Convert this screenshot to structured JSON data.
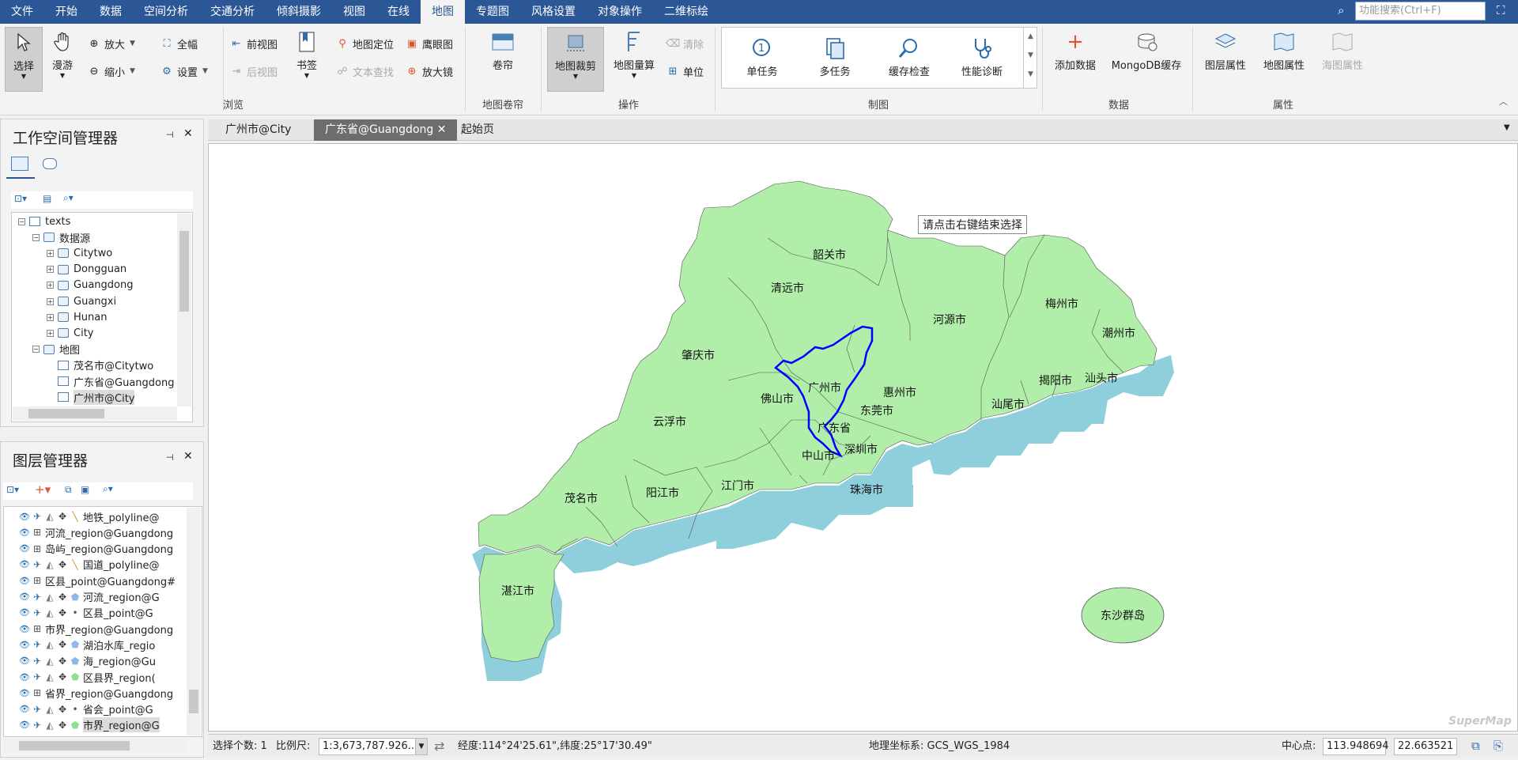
{
  "menu": [
    "文件",
    "开始",
    "数据",
    "空间分析",
    "交通分析",
    "倾斜摄影",
    "视图",
    "在线",
    "地图",
    "专题图",
    "风格设置",
    "对象操作",
    "二维标绘"
  ],
  "active_menu_index": 8,
  "search": {
    "placeholder": "功能搜索(Ctrl+F)"
  },
  "ribbon": {
    "browse": {
      "select": "选择",
      "pan": "漫游",
      "zoom_in": "放大",
      "zoom_out": "缩小",
      "full_extent": "全幅",
      "settings": "设置",
      "prev_view": "前视图",
      "next_view": "后视图",
      "bookmark": "书签",
      "locate": "地图定位",
      "text_search": "文本查找",
      "eagle_eye": "鹰眼图",
      "magnifier": "放大镜",
      "label": "浏览"
    },
    "swipe": {
      "swipe": "卷帘",
      "label": "地图卷帘"
    },
    "operate": {
      "clip": "地图裁剪",
      "measure": "地图量算",
      "clear": "清除",
      "unit": "单位",
      "label": "操作"
    },
    "mapping": {
      "single_task": "单任务",
      "multi_task": "多任务",
      "cache_check": "缓存检查",
      "diagnose": "性能诊断",
      "label": "制图"
    },
    "data": {
      "add_data": "添加数据",
      "mongodb": "MongoDB缓存",
      "label": "数据"
    },
    "props": {
      "layer_props": "图层属性",
      "map_props": "地图属性",
      "chart_props": "海图属性",
      "label": "属性"
    }
  },
  "workspace": {
    "title": "工作空间管理器",
    "tree": [
      {
        "label": "texts",
        "indent": 0,
        "type": "root"
      },
      {
        "label": "数据源",
        "indent": 1,
        "type": "folder"
      },
      {
        "label": "Citytwo",
        "indent": 2,
        "type": "db"
      },
      {
        "label": "Dongguan",
        "indent": 2,
        "type": "db"
      },
      {
        "label": "Guangdong",
        "indent": 2,
        "type": "db"
      },
      {
        "label": "Guangxi",
        "indent": 2,
        "type": "db"
      },
      {
        "label": "Hunan",
        "indent": 2,
        "type": "db"
      },
      {
        "label": "City",
        "indent": 2,
        "type": "db"
      },
      {
        "label": "地图",
        "indent": 1,
        "type": "folder"
      },
      {
        "label": "茂名市@Citytwo",
        "indent": 2,
        "type": "map"
      },
      {
        "label": "广东省@Guangdong",
        "indent": 2,
        "type": "map"
      },
      {
        "label": "广州市@City",
        "indent": 2,
        "type": "map"
      }
    ]
  },
  "layers": {
    "title": "图层管理器",
    "rows": [
      {
        "label": "地铁_polyline@",
        "indent": 1,
        "icon": "line"
      },
      {
        "label": "河流_region@Guangdong",
        "indent": 0,
        "icon": "group"
      },
      {
        "label": "岛屿_region@Guangdong",
        "indent": 0,
        "icon": "group"
      },
      {
        "label": "国道_polyline@",
        "indent": 1,
        "icon": "line"
      },
      {
        "label": "区县_point@Guangdong#",
        "indent": 0,
        "icon": "group"
      },
      {
        "label": "河流_region@G",
        "indent": 1,
        "icon": "region"
      },
      {
        "label": "区县_point@G",
        "indent": 1,
        "icon": "point"
      },
      {
        "label": "市界_region@Guangdong",
        "indent": 0,
        "icon": "group"
      },
      {
        "label": "湖泊水库_regio",
        "indent": 1,
        "icon": "region"
      },
      {
        "label": "海_region@Gu",
        "indent": 1,
        "icon": "region"
      },
      {
        "label": "区县界_region(",
        "indent": 1,
        "icon": "region-green"
      },
      {
        "label": "省界_region@Guangdong",
        "indent": 0,
        "icon": "group"
      },
      {
        "label": "省会_point@G",
        "indent": 1,
        "icon": "point"
      },
      {
        "label": "市界_region@G",
        "indent": 1,
        "icon": "region-green"
      }
    ]
  },
  "doc_tabs": [
    "广州市@City",
    "广东省@Guangdong",
    "起始页"
  ],
  "active_doc_tab": 1,
  "map": {
    "tooltip": "请点击右键结束选择",
    "cities": [
      "韶关市",
      "清远市",
      "河源市",
      "梅州市",
      "潮州市",
      "肇庆市",
      "揭阳市",
      "汕头市",
      "佛山市",
      "广州市",
      "惠州市",
      "汕尾市",
      "东莞市",
      "广东省",
      "云浮市",
      "中山市",
      "深圳市",
      "珠海市",
      "江门市",
      "茂名市",
      "阳江市",
      "湛江市",
      "东沙群岛"
    ],
    "watermark": "SuperMap"
  },
  "status": {
    "selected_label": "选择个数: 1",
    "scale_label": "比例尺:",
    "scale_value": "1:3,673,787.926...",
    "coords": "经度:114°24'25.61\",纬度:25°17'30.49\"",
    "crs": "地理坐标系: GCS_WGS_1984",
    "center_label": "中心点:",
    "center_x": "113.948694",
    "center_y": "22.663521"
  },
  "colors": {
    "accent": "#2b5797",
    "land": "#b1eea9",
    "sea": "#8fcfdc",
    "selection": "#0000ff"
  }
}
